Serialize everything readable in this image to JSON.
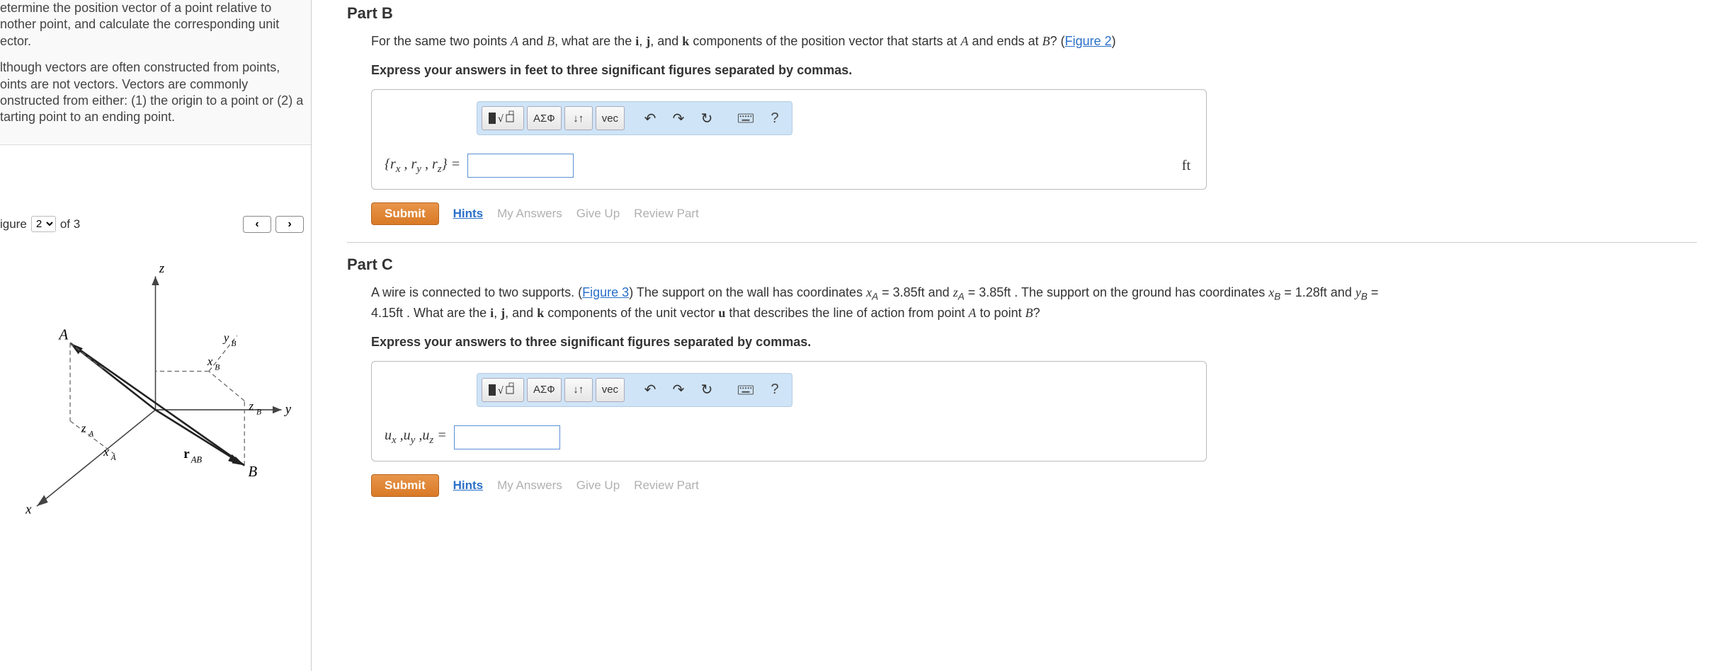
{
  "left": {
    "intro_p1": "etermine the position vector of a point relative to nother point, and calculate the corresponding unit ector.",
    "intro_p2": "lthough vectors are often constructed from points, oints are not vectors. Vectors are commonly onstructed from either: (1) the origin to a point or (2) a tarting point to an ending point.",
    "figure_label": "igure",
    "figure_select_value": "2",
    "figure_of": "of 3",
    "fig_labels": {
      "z": "z",
      "y": "y",
      "x": "x",
      "A": "A",
      "B": "B",
      "xA": "xA",
      "zA": "zA",
      "xB": "xB",
      "yB": "yB",
      "zB": "zB",
      "rAB": "rAB"
    }
  },
  "partB": {
    "title": "Part B",
    "prompt_pre": "For the same two points ",
    "prompt_mid": ", what are the ",
    "prompt_comp": " components of the position vector that starts at ",
    "prompt_end1": " and ends at ",
    "prompt_end2": "? ",
    "figure_link": "Figure 2",
    "instr": "Express your answers in feet to three significant figures separated by commas.",
    "toolbar": {
      "greek": "ΑΣФ",
      "vec": "vec",
      "help": "?"
    },
    "var_label": "{rₓ , r_y , r_z} =",
    "unit": "ft",
    "input_value": ""
  },
  "partC": {
    "title": "Part C",
    "sentence1_a": "A wire is connected to two supports. (",
    "figure_link": "Figure 3",
    "sentence1_b": ") The support on the wall has coordinates ",
    "xA_val": " = 3.85ft ",
    "and1": " and ",
    "zA_val": " = 3.85ft ",
    "sentence1_c": ". The support on the ground has coordinates ",
    "xB_val": " = 1.28ft ",
    "and2": " and ",
    "yB_val": " = 4.15ft ",
    "sentence1_d": ". What are the ",
    "sentence1_e": " components of the unit vector ",
    "sentence1_f": " that describes the line of action from point ",
    "sentence1_g": " to point ",
    "instr": "Express your answers to three significant figures separated by commas.",
    "var_label": "uₓ ,u_y ,u_z =",
    "input_value": ""
  },
  "actions": {
    "submit": "Submit",
    "hints": "Hints",
    "my_answers": "My Answers",
    "give_up": "Give Up",
    "review": "Review Part"
  }
}
